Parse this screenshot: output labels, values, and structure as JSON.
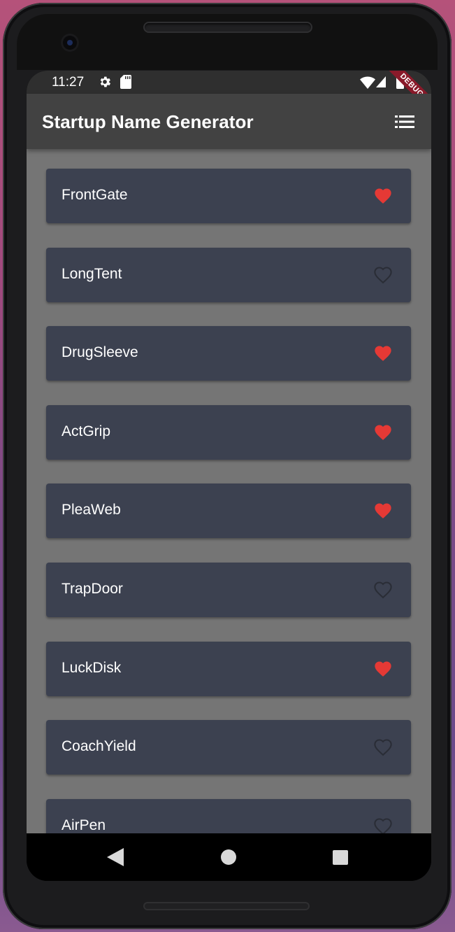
{
  "status_bar": {
    "time": "11:27",
    "icons": [
      "gear-icon",
      "sd-card-icon",
      "wifi-icon",
      "signal-icon",
      "battery-icon"
    ],
    "debug_banner": "DEBUG"
  },
  "app_bar": {
    "title": "Startup Name Generator",
    "action_icon": "list-icon"
  },
  "colors": {
    "app_bar": "#424242",
    "list_background": "#757575",
    "card": "#3c4150",
    "favorite": "#e53935",
    "not_favorite_outline": "#2a2d36"
  },
  "names": [
    {
      "label": "FrontGate",
      "saved": true
    },
    {
      "label": "LongTent",
      "saved": false
    },
    {
      "label": "DrugSleeve",
      "saved": true
    },
    {
      "label": "ActGrip",
      "saved": true
    },
    {
      "label": "PleaWeb",
      "saved": true
    },
    {
      "label": "TrapDoor",
      "saved": false
    },
    {
      "label": "LuckDisk",
      "saved": true
    },
    {
      "label": "CoachYield",
      "saved": false
    },
    {
      "label": "AirPen",
      "saved": false
    }
  ],
  "nav_bar": {
    "icons": [
      "back-icon",
      "home-icon",
      "recents-icon"
    ]
  }
}
